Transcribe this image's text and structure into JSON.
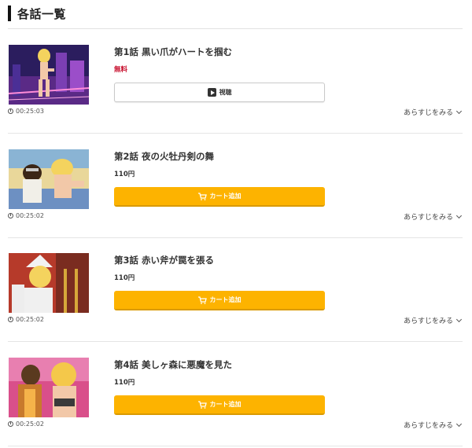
{
  "section": {
    "title": "各話一覧"
  },
  "episodes": [
    {
      "title": "第1話 黒い爪がハートを掴む",
      "price": "無料",
      "button": "視聴",
      "duration": "00:25:03",
      "synopsis": "あらすじをみる"
    },
    {
      "title": "第2話 夜の火牡丹剣の舞",
      "price": "110円",
      "button": "カート追加",
      "duration": "00:25:02",
      "synopsis": "あらすじをみる"
    },
    {
      "title": "第3話 赤い斧が罠を張る",
      "price": "110円",
      "button": "カート追加",
      "duration": "00:25:02",
      "synopsis": "あらすじをみる"
    },
    {
      "title": "第4話 美しヶ森に悪魔を見た",
      "price": "110円",
      "button": "カート追加",
      "duration": "00:25:02",
      "synopsis": "あらすじをみる"
    }
  ],
  "colors": {
    "cart_button": "#fdb300",
    "free_price": "#c8102e",
    "watch_button_border": "#c9c9c9"
  },
  "icons": {
    "clock": "clock-icon",
    "play": "play-icon",
    "cart": "cart-icon",
    "chevron": "chevron-down-icon"
  }
}
